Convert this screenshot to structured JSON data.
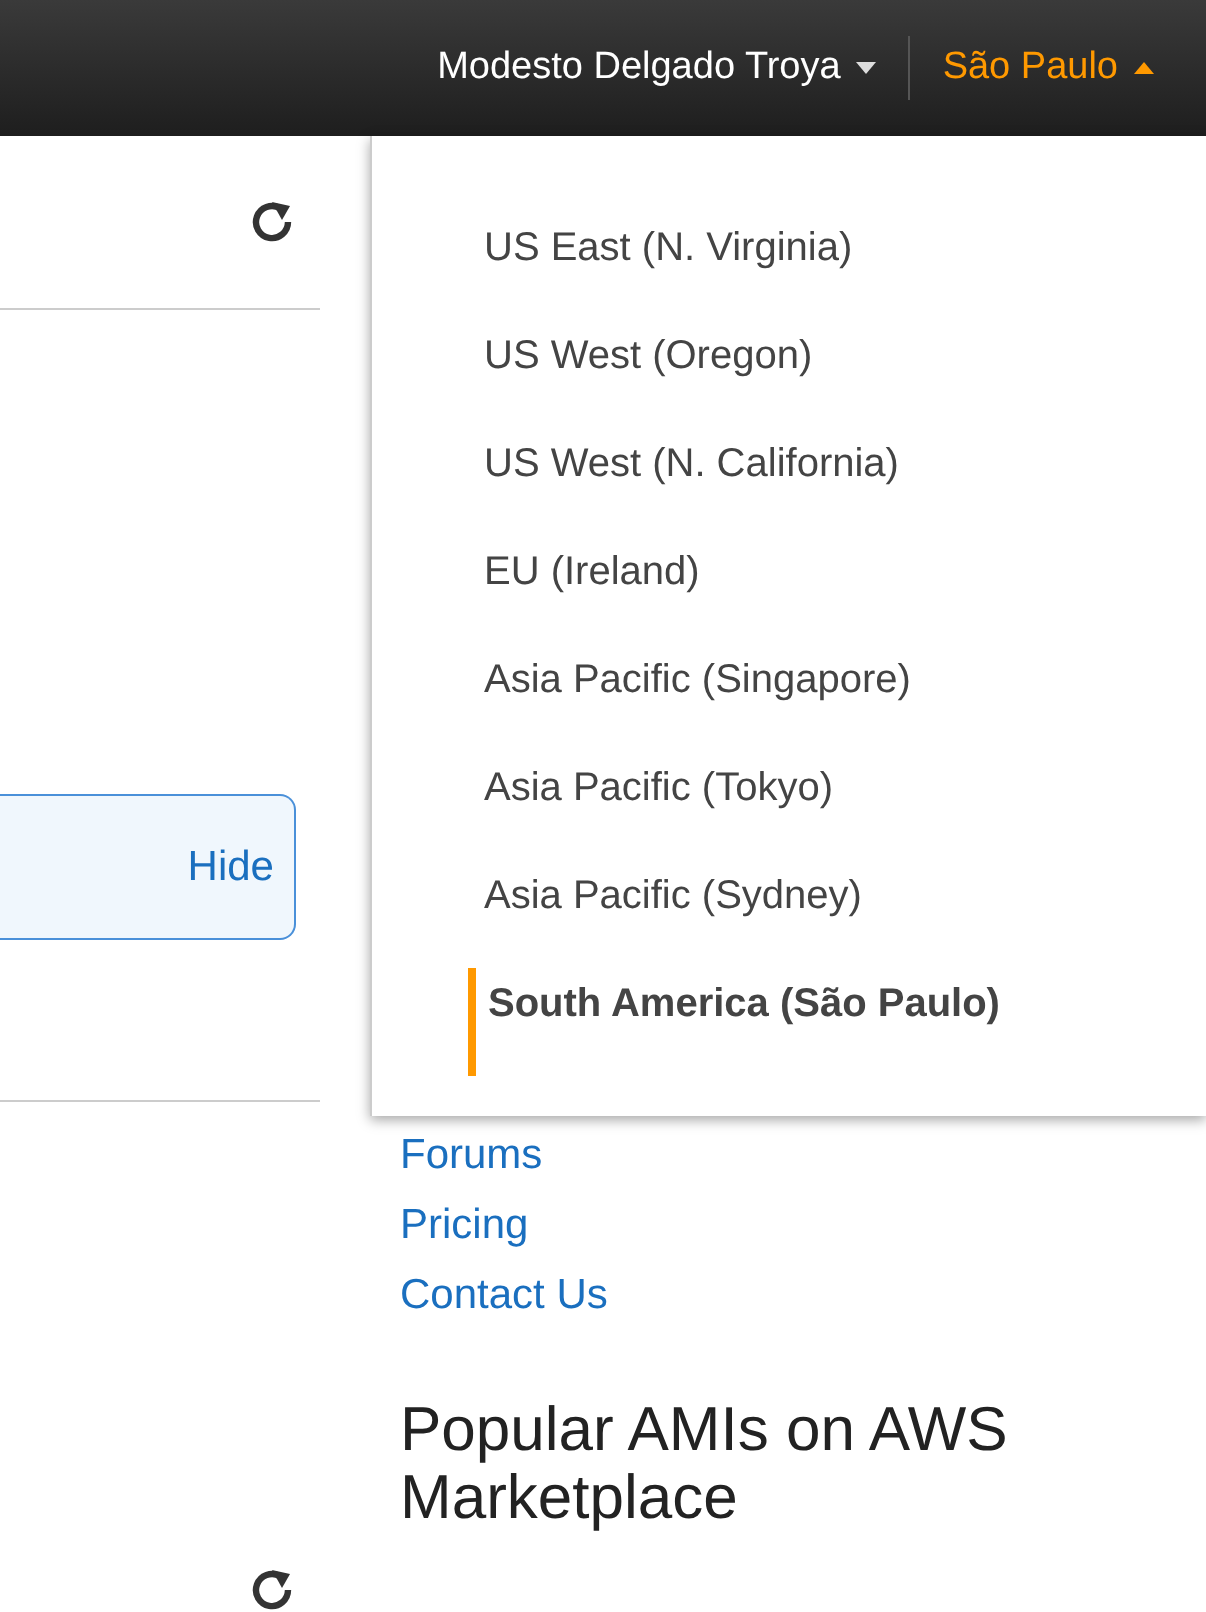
{
  "topbar": {
    "user": "Modesto Delgado Troya",
    "region": "São Paulo",
    "region_menu_open": true
  },
  "left_panel": {
    "hide_link": "Hide"
  },
  "region_menu": [
    {
      "label": "US East (N. Virginia)",
      "selected": false
    },
    {
      "label": "US West (Oregon)",
      "selected": false
    },
    {
      "label": "US West (N. California)",
      "selected": false
    },
    {
      "label": "EU (Ireland)",
      "selected": false
    },
    {
      "label": "Asia Pacific (Singapore)",
      "selected": false
    },
    {
      "label": "Asia Pacific (Tokyo)",
      "selected": false
    },
    {
      "label": "Asia Pacific (Sydney)",
      "selected": false
    },
    {
      "label": "South America (São Paulo)",
      "selected": true
    }
  ],
  "links": [
    "Forums",
    "Pricing",
    "Contact Us"
  ],
  "heading": "Popular AMIs on AWS Marketplace"
}
